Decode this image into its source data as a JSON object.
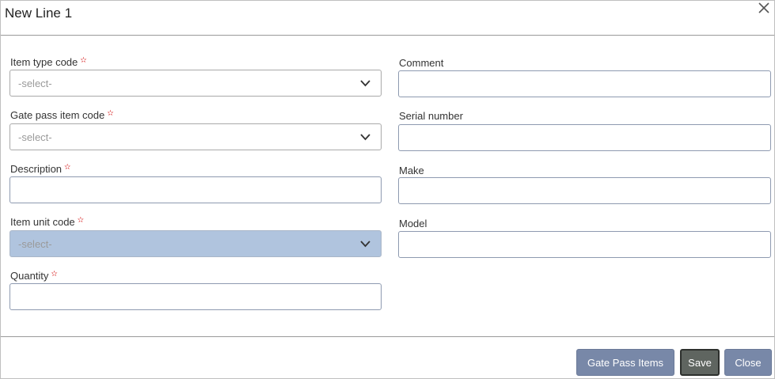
{
  "dialog": {
    "title": "New Line 1",
    "close_icon": "close-icon"
  },
  "required_marker": "✫",
  "left_column": {
    "item_type_code": {
      "label": "Item type code",
      "value": "-select-"
    },
    "gate_pass_item_code": {
      "label": "Gate pass item code",
      "value": "-select-"
    },
    "description": {
      "label": "Description",
      "value": ""
    },
    "item_unit_code": {
      "label": "Item unit code",
      "value": "-select-"
    },
    "quantity": {
      "label": "Quantity",
      "value": ""
    }
  },
  "right_column": {
    "comment": {
      "label": "Comment",
      "value": ""
    },
    "serial_number": {
      "label": "Serial number",
      "value": ""
    },
    "make": {
      "label": "Make",
      "value": ""
    },
    "model": {
      "label": "Model",
      "value": ""
    }
  },
  "footer": {
    "gate_pass_items_label": "Gate Pass Items",
    "save_label": "Save",
    "close_label": "Close"
  }
}
